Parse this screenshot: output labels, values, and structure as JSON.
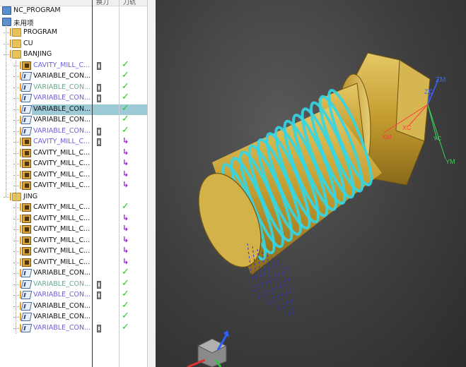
{
  "header": {
    "col_toolpath": "换刀",
    "col_status": "刀轨"
  },
  "tree": [
    {
      "depth": 0,
      "type": "root",
      "label": "NC_PROGRAM"
    },
    {
      "depth": 0,
      "type": "root",
      "label": "未用项"
    },
    {
      "depth": 1,
      "type": "folder",
      "label": "PROGRAM",
      "warn": true
    },
    {
      "depth": 1,
      "type": "folder",
      "label": "CU",
      "warn": true
    },
    {
      "depth": 1,
      "type": "folder",
      "label": "BANJING",
      "warn": true
    },
    {
      "depth": 2,
      "type": "op",
      "label": "CAVITY_MILL_C...",
      "color": "blue",
      "tool": true,
      "status": "check",
      "warn": true
    },
    {
      "depth": 2,
      "type": "op2",
      "label": "VARIABLE_CON...",
      "color": "black",
      "tool": false,
      "status": "check",
      "warn": true
    },
    {
      "depth": 2,
      "type": "op2",
      "label": "VARIABLE_CON...",
      "color": "green",
      "tool": true,
      "status": "check",
      "warn": true
    },
    {
      "depth": 2,
      "type": "op2",
      "label": "VARIABLE_CON...",
      "color": "blue",
      "tool": true,
      "status": "check",
      "warn": true
    },
    {
      "depth": 2,
      "type": "op2",
      "label": "VARIABLE_CON...",
      "color": "black",
      "tool": false,
      "status": "check",
      "warn": true,
      "selected": true
    },
    {
      "depth": 2,
      "type": "op2",
      "label": "VARIABLE_CON...",
      "color": "black",
      "tool": false,
      "status": "check",
      "warn": true
    },
    {
      "depth": 2,
      "type": "op2",
      "label": "VARIABLE_CON...",
      "color": "blue",
      "tool": true,
      "status": "check",
      "warn": true
    },
    {
      "depth": 2,
      "type": "op",
      "label": "CAVITY_MILL_C...",
      "color": "blue",
      "tool": true,
      "status": "arrow",
      "warn": true
    },
    {
      "depth": 2,
      "type": "op",
      "label": "CAVITY_MILL_C...",
      "color": "black",
      "tool": false,
      "status": "arrow",
      "warn": true
    },
    {
      "depth": 2,
      "type": "op",
      "label": "CAVITY_MILL_C...",
      "color": "black",
      "tool": false,
      "status": "arrow",
      "warn": true
    },
    {
      "depth": 2,
      "type": "op",
      "label": "CAVITY_MILL_C...",
      "color": "black",
      "tool": false,
      "status": "arrow",
      "warn": true
    },
    {
      "depth": 2,
      "type": "op",
      "label": "CAVITY_MILL_C...",
      "color": "black",
      "tool": false,
      "status": "arrow",
      "warn": true
    },
    {
      "depth": 1,
      "type": "folder",
      "label": "JING",
      "warn": true
    },
    {
      "depth": 2,
      "type": "op",
      "label": "CAVITY_MILL_C...",
      "color": "black",
      "tool": false,
      "status": "check",
      "warn": true
    },
    {
      "depth": 2,
      "type": "op",
      "label": "CAVITY_MILL_C...",
      "color": "black",
      "tool": false,
      "status": "arrow",
      "warn": true
    },
    {
      "depth": 2,
      "type": "op",
      "label": "CAVITY_MILL_C...",
      "color": "black",
      "tool": false,
      "status": "arrow",
      "warn": true
    },
    {
      "depth": 2,
      "type": "op",
      "label": "CAVITY_MILL_C...",
      "color": "black",
      "tool": false,
      "status": "arrow",
      "warn": true
    },
    {
      "depth": 2,
      "type": "op",
      "label": "CAVITY_MILL_C...",
      "color": "black",
      "tool": false,
      "status": "arrow",
      "warn": true
    },
    {
      "depth": 2,
      "type": "op",
      "label": "CAVITY_MILL_C...",
      "color": "black",
      "tool": false,
      "status": "arrow",
      "warn": true
    },
    {
      "depth": 2,
      "type": "op2",
      "label": "VARIABLE_CON...",
      "color": "black",
      "tool": false,
      "status": "check",
      "warn": true
    },
    {
      "depth": 2,
      "type": "op2",
      "label": "VARIABLE_CON...",
      "color": "green",
      "tool": true,
      "status": "check",
      "warn": true
    },
    {
      "depth": 2,
      "type": "op2",
      "label": "VARIABLE_CON...",
      "color": "blue",
      "tool": true,
      "status": "check",
      "warn": true
    },
    {
      "depth": 2,
      "type": "op2",
      "label": "VARIABLE_CON...",
      "color": "black",
      "tool": false,
      "status": "check",
      "warn": true
    },
    {
      "depth": 2,
      "type": "op2",
      "label": "VARIABLE_CON...",
      "color": "black",
      "tool": false,
      "status": "check",
      "warn": true
    },
    {
      "depth": 2,
      "type": "op2",
      "label": "VARIABLE_CON...",
      "color": "blue",
      "tool": true,
      "status": "check",
      "warn": true
    }
  ],
  "viewport": {
    "axis_labels": {
      "zm": "ZM",
      "zc": "ZC",
      "xm": "XM",
      "xc": "XC",
      "yc": "YC",
      "ym": "YM"
    },
    "colors": {
      "part": "#c8a43c",
      "toolpath": "#33d6e6",
      "background": "#3e3e3e"
    }
  }
}
